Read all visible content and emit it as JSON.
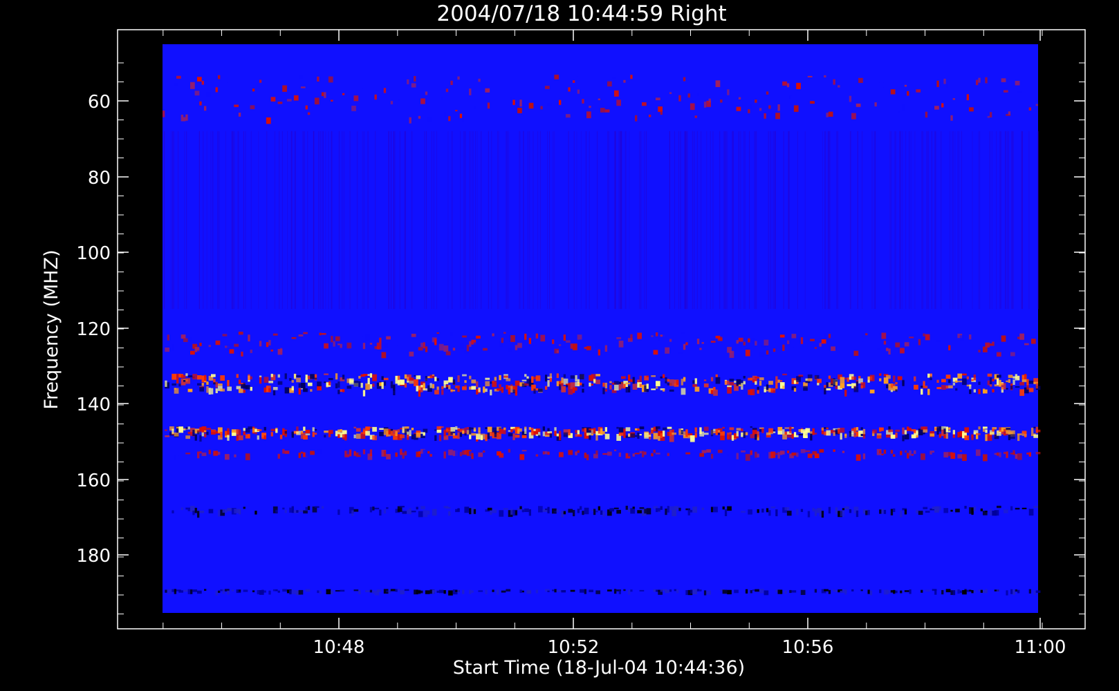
{
  "chart_data": {
    "type": "heatmap",
    "title": "2004/07/18 10:44:59 Right",
    "xlabel": "Start Time (18-Jul-04 10:44:36)",
    "ylabel": "Frequency (MHZ)",
    "x_ticks": [
      "10:48",
      "10:52",
      "10:56",
      "11:00"
    ],
    "y_ticks": [
      "60",
      "80",
      "100",
      "120",
      "140",
      "160",
      "180"
    ],
    "x_range": [
      "10:44:36",
      "11:00:15"
    ],
    "y_range": [
      45,
      200
    ],
    "y_axis_inverted": true,
    "colormap": [
      "#000000",
      "#1010ff",
      "#e01000",
      "#ff3a00",
      "#ffa020",
      "#ffff90"
    ],
    "background_level_color": "#1010ff",
    "emission_bands": [
      {
        "freq_low": 53,
        "freq_high": 65,
        "level": "moderate"
      },
      {
        "freq_low": 121,
        "freq_high": 127,
        "level": "moderate"
      },
      {
        "freq_low": 132,
        "freq_high": 137,
        "level": "strong"
      },
      {
        "freq_low": 146,
        "freq_high": 149,
        "level": "strong"
      },
      {
        "freq_low": 152,
        "freq_high": 154,
        "level": "moderate"
      },
      {
        "freq_low": 167,
        "freq_high": 169,
        "level": "low"
      },
      {
        "freq_low": 189,
        "freq_high": 190,
        "level": "low"
      }
    ]
  }
}
